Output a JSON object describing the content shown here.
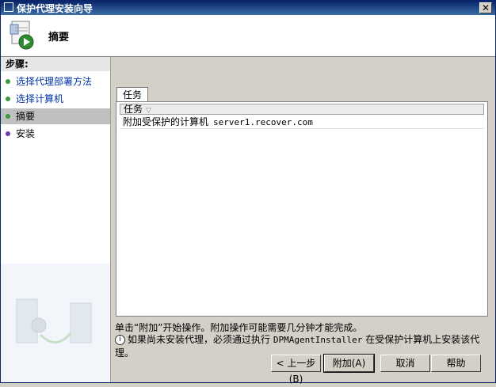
{
  "window": {
    "title": "保护代理安装向导",
    "close_label": "✕"
  },
  "header": {
    "heading": "摘要",
    "icon": "wizard-icon"
  },
  "steps": {
    "title": "步骤:",
    "items": [
      {
        "label": "选择代理部署方法",
        "state": "done"
      },
      {
        "label": "选择计算机",
        "state": "done"
      },
      {
        "label": "摘要",
        "state": "current"
      },
      {
        "label": "安装",
        "state": "pending"
      }
    ]
  },
  "main": {
    "tab_label": "任务",
    "column_header": "任务",
    "sort_indicator": "▽",
    "task_row": {
      "text": "附加受保护的计算机",
      "server": "server1.recover.com"
    },
    "message1": "单击“附加”开始操作。附加操作可能需要几分钟才能完成。",
    "message2_prefix": "如果尚未安装代理，必须通过执行 ",
    "message2_cmd": "DPMAgentInstaller",
    "message2_suffix": " 在受保护计算机上安装该代理。"
  },
  "buttons": {
    "back": "< 上一步(B)",
    "attach": "附加(A)",
    "cancel": "取消",
    "help": "帮助"
  },
  "colors": {
    "title_bar": "#0a246a",
    "link": "#0033aa",
    "done_dot": "#3a9a3a",
    "pending_dot": "#6a3aaa"
  }
}
